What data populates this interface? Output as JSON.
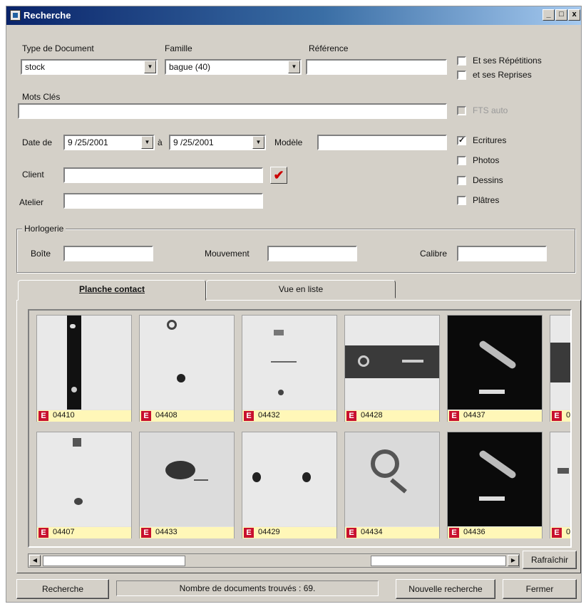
{
  "window": {
    "title": "Recherche",
    "minimize": "_",
    "maximize": "□",
    "close": "x"
  },
  "form": {
    "type_document": {
      "label": "Type de Document",
      "value": "stock"
    },
    "famille": {
      "label": "Famille",
      "value": "bague (40)"
    },
    "reference": {
      "label": "Référence",
      "value": ""
    },
    "mots_cles": {
      "label": "Mots Clés",
      "value": ""
    },
    "date_de": {
      "label": "Date de",
      "value": "9 /25/2001"
    },
    "date_a": {
      "label": "à",
      "value": "9 /25/2001"
    },
    "modele": {
      "label": "Modèle",
      "value": ""
    },
    "client": {
      "label": "Client",
      "value": ""
    },
    "atelier": {
      "label": "Atelier",
      "value": ""
    }
  },
  "checkboxes": {
    "repetitions": {
      "label": "Et ses Répétitions",
      "checked": false
    },
    "reprises": {
      "label": "et ses Reprises",
      "checked": false
    },
    "fts_auto": {
      "label": "FTS auto",
      "checked": false,
      "disabled": true
    },
    "ecritures": {
      "label": "Ecritures",
      "checked": true
    },
    "photos": {
      "label": "Photos",
      "checked": false
    },
    "dessins": {
      "label": "Dessins",
      "checked": false
    },
    "platres": {
      "label": "Plâtres",
      "checked": false
    }
  },
  "horlogerie": {
    "label": "Horlogerie",
    "boite": "Boîte",
    "mouvement": "Mouvement",
    "calibre": "Calibre"
  },
  "tabs": {
    "contact": "Planche contact",
    "liste": "Vue en liste"
  },
  "thumbs_row1": [
    "04410",
    "04408",
    "04432",
    "04428",
    "04437",
    "0"
  ],
  "thumbs_row2": [
    "04407",
    "04433",
    "04429",
    "04434",
    "04436",
    "0"
  ],
  "badge": "E",
  "buttons": {
    "rafraichir": "Rafraîchir",
    "recherche": "Recherche",
    "nouvelle": "Nouvelle recherche",
    "fermer": "Fermer"
  },
  "status": "Nombre de documents trouvés : 69."
}
